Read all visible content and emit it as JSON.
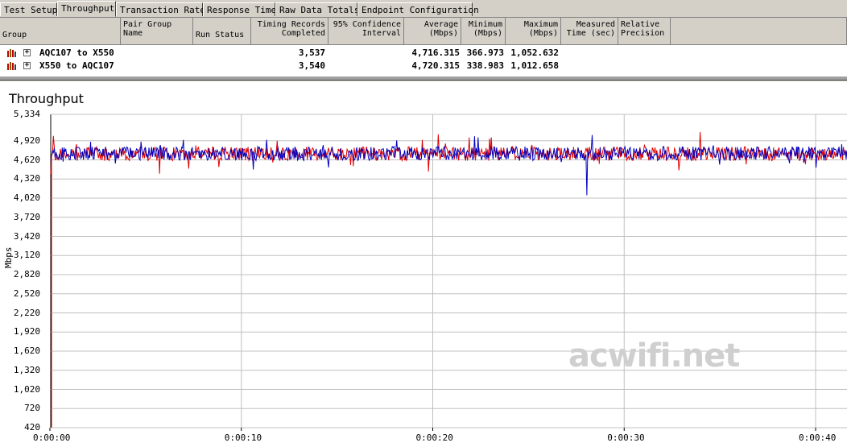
{
  "tabs": [
    "Test Setup",
    "Throughput",
    "Transaction Rate",
    "Response Time",
    "Raw Data Totals",
    "Endpoint Configuration"
  ],
  "active_tab": "Throughput",
  "table": {
    "headers": [
      "Group",
      "Pair Group\nName",
      "Run Status",
      "Timing Records\nCompleted",
      "95% Confidence\nInterval",
      "Average\n(Mbps)",
      "Minimum\n(Mbps)",
      "Maximum\n(Mbps)",
      "Measured\nTime (sec)",
      "Relative\nPrecision"
    ],
    "rows": [
      {
        "name": "AQC107 to X550",
        "records": "3,537",
        "average": "4,716.315",
        "minimum": "366.973",
        "maximum": "1,052.632"
      },
      {
        "name": "X550 to AQC107",
        "records": "3,540",
        "average": "4,720.315",
        "minimum": "338.983",
        "maximum": "1,012.658"
      }
    ]
  },
  "chart": {
    "title": "Throughput",
    "y_axis_label": "Mbps",
    "watermark": "acwifi.net",
    "colors": {
      "series1": "#e00000",
      "series2": "#0000c0",
      "grid": "#c0c0c0"
    }
  },
  "chart_data": {
    "type": "line",
    "title": "Throughput",
    "ylabel": "Mbps",
    "xlabel": "",
    "ylim": [
      420,
      5334
    ],
    "y_ticks": [
      "5,334",
      "4,920",
      "4,620",
      "4,320",
      "4,020",
      "3,720",
      "3,420",
      "3,120",
      "2,820",
      "2,520",
      "2,220",
      "1,920",
      "1,620",
      "1,320",
      "1,020",
      "720",
      "420"
    ],
    "x_ticks": [
      "0:00:00",
      "0:00:10",
      "0:00:20",
      "0:00:30",
      "0:00:40"
    ],
    "series": [
      {
        "name": "AQC107 to X550",
        "color": "red",
        "mean": 4716,
        "min_point": {
          "t": 0,
          "v": 420
        },
        "max_point": {
          "t": 0.2,
          "v": 4995
        }
      },
      {
        "name": "X550 to AQC107",
        "color": "blue",
        "mean": 4720,
        "min_point": {
          "t": 28,
          "v": 4065
        }
      }
    ],
    "grid": true
  }
}
